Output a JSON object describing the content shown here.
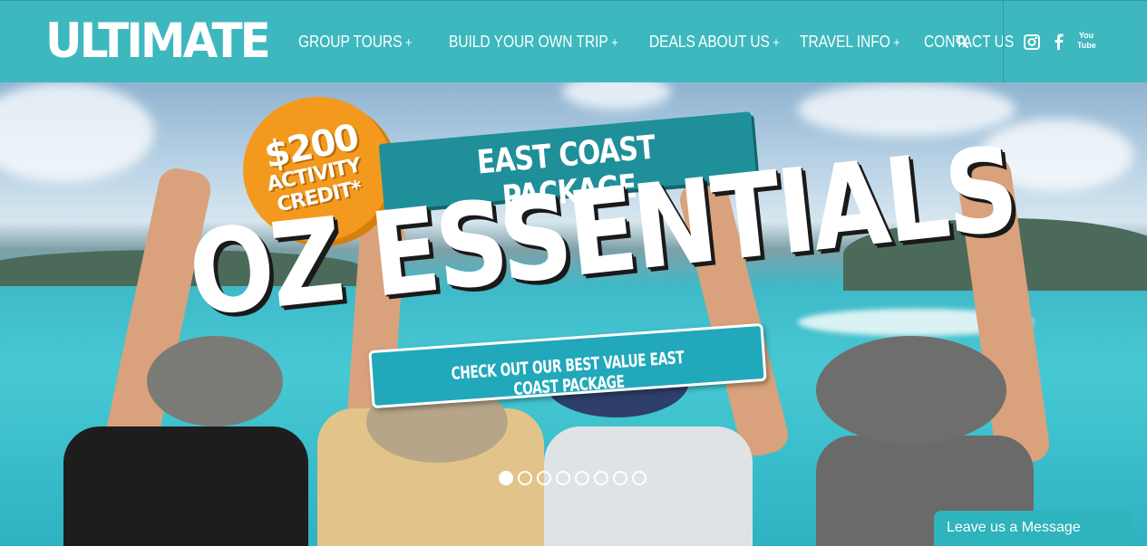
{
  "header": {
    "logo": "ULTIMATE",
    "nav": [
      {
        "label": "GROUP TOURS",
        "plus": "+"
      },
      {
        "label": "BUILD YOUR OWN TRIP",
        "plus": "+"
      },
      {
        "label": "DEALS",
        "plus": ""
      },
      {
        "label": "ABOUT US",
        "plus": "+"
      },
      {
        "label": "TRAVEL INFO",
        "plus": "+"
      },
      {
        "label": "CONTACT US",
        "plus": ""
      }
    ],
    "icons": [
      "search-icon",
      "instagram-icon",
      "facebook-icon",
      "youtube-icon"
    ],
    "youtube_text": "You Tube"
  },
  "hero": {
    "badge_amount": "$200",
    "badge_line1": "ACTIVITY",
    "badge_line2": "CREDIT*",
    "banner": "EAST COAST PACKAGE",
    "headline": "OZ ESSENTIALS",
    "cta": "CHECK OUT OUR BEST VALUE EAST COAST PACKAGE",
    "slides_total": 8,
    "slide_active": 1
  },
  "chat": {
    "label": "Leave us a Message"
  },
  "colors": {
    "header": "#3db8be",
    "badge": "#f39a1e",
    "banner": "#1f8f9a",
    "cta": "#21a8ba"
  }
}
